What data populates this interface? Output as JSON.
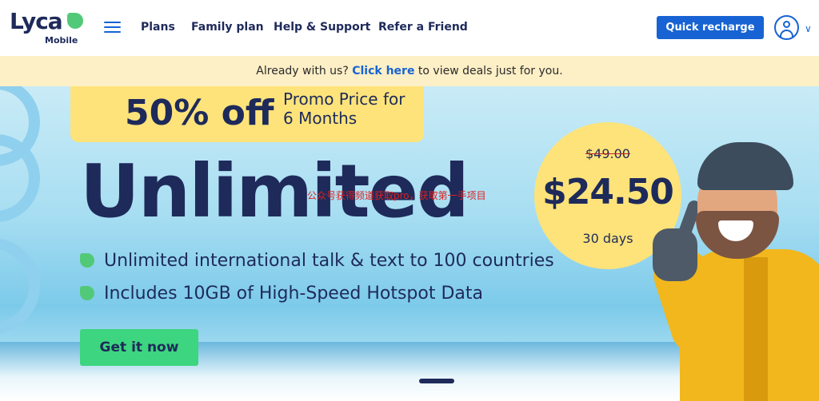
{
  "brand": {
    "name": "Lyca",
    "sub": "Mobile",
    "accent": "#52c978",
    "navy": "#1e2a5a",
    "blue": "#1763d3"
  },
  "nav": {
    "items": [
      {
        "label": "Plans"
      },
      {
        "label": "Family plan"
      },
      {
        "label": "Help & Support"
      },
      {
        "label": "Refer a Friend"
      }
    ],
    "quick_recharge": "Quick recharge",
    "menu_icon": "hamburger-icon",
    "account_icon": "user-icon",
    "account_chevron": "chevron-down-icon",
    "chevron_glyph": "∨"
  },
  "infobar": {
    "prefix": "Already with us?",
    "link": "Click here",
    "suffix": "to view deals just for you.",
    "background": "#fdefc6"
  },
  "hero": {
    "promo_big": "50% off",
    "promo_line": "Promo Price for 6 Months",
    "headline": "Unlimited",
    "watermark": "公众号获得频道获取pro，获取第一手项目",
    "features": [
      "Unlimited international talk & text to 100 countries",
      "Includes 10GB of High-Speed Hotspot Data"
    ],
    "cta": "Get it now",
    "old_price": "$49.00",
    "price": "$24.50",
    "period": "30 days",
    "cta_color": "#3dd57f",
    "badge_color": "#fde37a"
  }
}
